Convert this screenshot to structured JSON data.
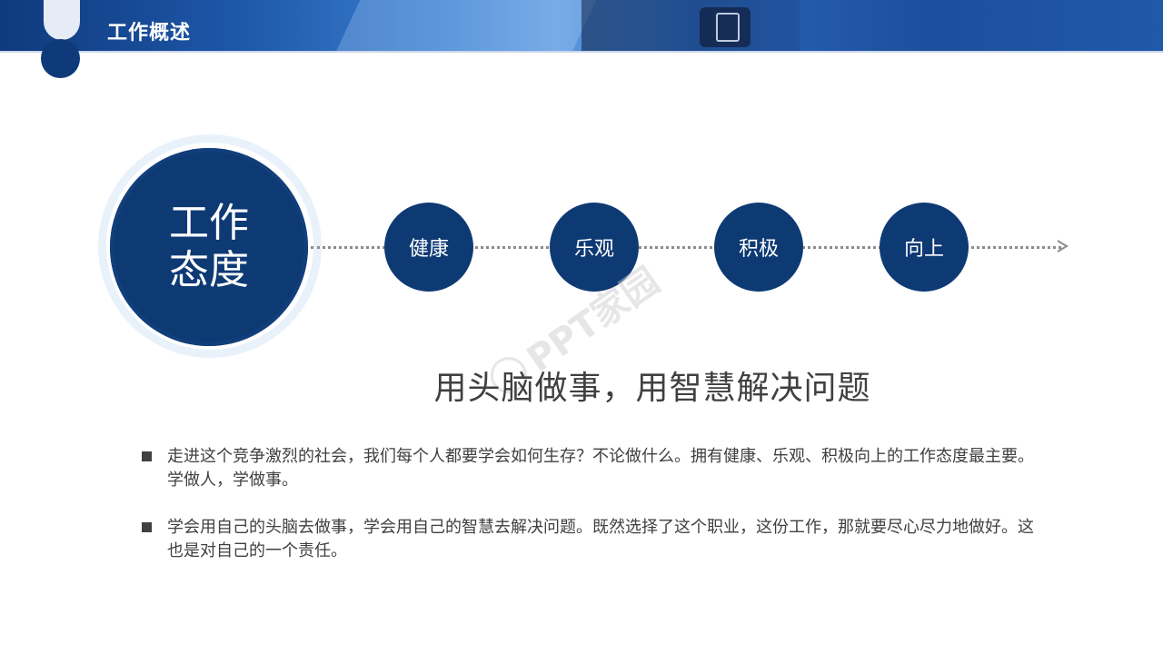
{
  "header": {
    "title": "工作概述"
  },
  "main_circle": {
    "label": "工作态度"
  },
  "steps": [
    {
      "label": "健康"
    },
    {
      "label": "乐观"
    },
    {
      "label": "积极"
    },
    {
      "label": "向上"
    }
  ],
  "headline": "用头脑做事，用智慧解决问题",
  "bullets": [
    {
      "text": "走进这个竞争激烈的社会，我们每个人都要学会如何生存？不论做什么。拥有健康、乐观、积极向上的工作态度最主要。学做人，学做事。"
    },
    {
      "text": "学会用自己的头脑去做事，学会用自己的智慧去解决问题。既然选择了这个职业，这份工作，那就要尽心尽力地做好。这也是对自己的一个责任。"
    }
  ],
  "watermark": {
    "text": "PPT家园"
  },
  "colors": {
    "primary": "#0e3a74",
    "text": "#404040",
    "header": "#1d56a8"
  }
}
